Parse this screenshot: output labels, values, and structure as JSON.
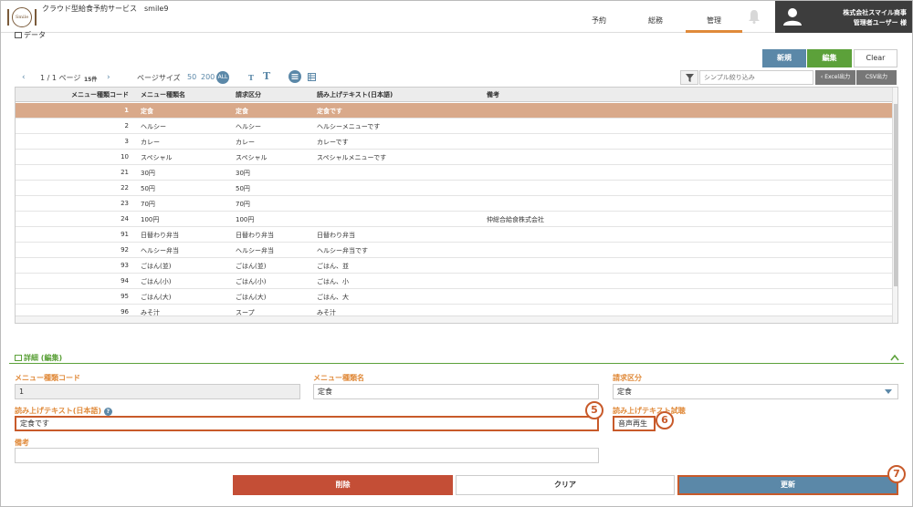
{
  "app": {
    "logo_text": "Smile",
    "title": "クラウド型給食予約サービス　smile9"
  },
  "nav": [
    {
      "label": "予約"
    },
    {
      "label": "総務"
    },
    {
      "label": "管理"
    }
  ],
  "user": {
    "company": "株式会社スマイル商事",
    "role": "管理者ユーザー 様"
  },
  "data_section": {
    "title": "データ"
  },
  "toolbar": {
    "new_label": "新規",
    "edit_label": "編集",
    "clear_label": "Clear"
  },
  "pager": {
    "page": "1 / 1 ページ",
    "count": "15件",
    "size_label": "ページサイズ",
    "size_50": "50",
    "size_200": "200",
    "size_all": "ALL",
    "font_small": "T",
    "font_large": "T"
  },
  "filter": {
    "placeholder": "シンプル絞り込み",
    "excel_label": "‹ Excel出力",
    "csv_label": "CSV出力"
  },
  "table": {
    "columns": [
      "メニュー種類コード",
      "メニュー種類名",
      "請求区分",
      "読み上げテキスト(日本語)",
      "備考"
    ],
    "rows": [
      [
        "1",
        "定食",
        "定食",
        "定食です",
        ""
      ],
      [
        "2",
        "ヘルシー",
        "ヘルシー",
        "ヘルシーメニューです",
        ""
      ],
      [
        "3",
        "カレー",
        "カレー",
        "カレーです",
        ""
      ],
      [
        "10",
        "スペシャル",
        "スペシャル",
        "スペシャルメニューです",
        ""
      ],
      [
        "21",
        "30円",
        "30円",
        "",
        ""
      ],
      [
        "22",
        "50円",
        "50円",
        "",
        ""
      ],
      [
        "23",
        "70円",
        "70円",
        "",
        ""
      ],
      [
        "24",
        "100円",
        "100円",
        "",
        "仲総合給食株式会社"
      ],
      [
        "91",
        "日替わり弁当",
        "日替わり弁当",
        "日替わり弁当",
        ""
      ],
      [
        "92",
        "ヘルシー弁当",
        "ヘルシー弁当",
        "ヘルシー弁当です",
        ""
      ],
      [
        "93",
        "ごはん(並)",
        "ごはん(並)",
        "ごはん、並",
        ""
      ],
      [
        "94",
        "ごはん(小)",
        "ごはん(小)",
        "ごはん、小",
        ""
      ],
      [
        "95",
        "ごはん(大)",
        "ごはん(大)",
        "ごはん、大",
        ""
      ],
      [
        "96",
        "みそ汁",
        "スープ",
        "みそ汁",
        ""
      ]
    ]
  },
  "detail": {
    "title": "詳細 (編集)",
    "code_label": "メニュー種類コード",
    "code_value": "1",
    "name_label": "メニュー種類名",
    "name_value": "定食",
    "billing_label": "請求区分",
    "billing_value": "定食",
    "tts_label": "読み上げテキスト(日本語)",
    "tts_value": "定食です",
    "tts_check_label": "読み上げテキスト試聴",
    "tts_play_label": "音声再生",
    "note_label": "備考",
    "note_value": ""
  },
  "markers": {
    "m5": "5",
    "m6": "6",
    "m7": "7"
  },
  "actions": {
    "delete_label": "削除",
    "clear_label": "クリア",
    "update_label": "更新"
  },
  "colors": {
    "accent": "#e08a3a",
    "primary": "#5b88a8",
    "success": "#5ca13a",
    "danger": "#c44e36",
    "selected_row": "#d9a98a"
  }
}
